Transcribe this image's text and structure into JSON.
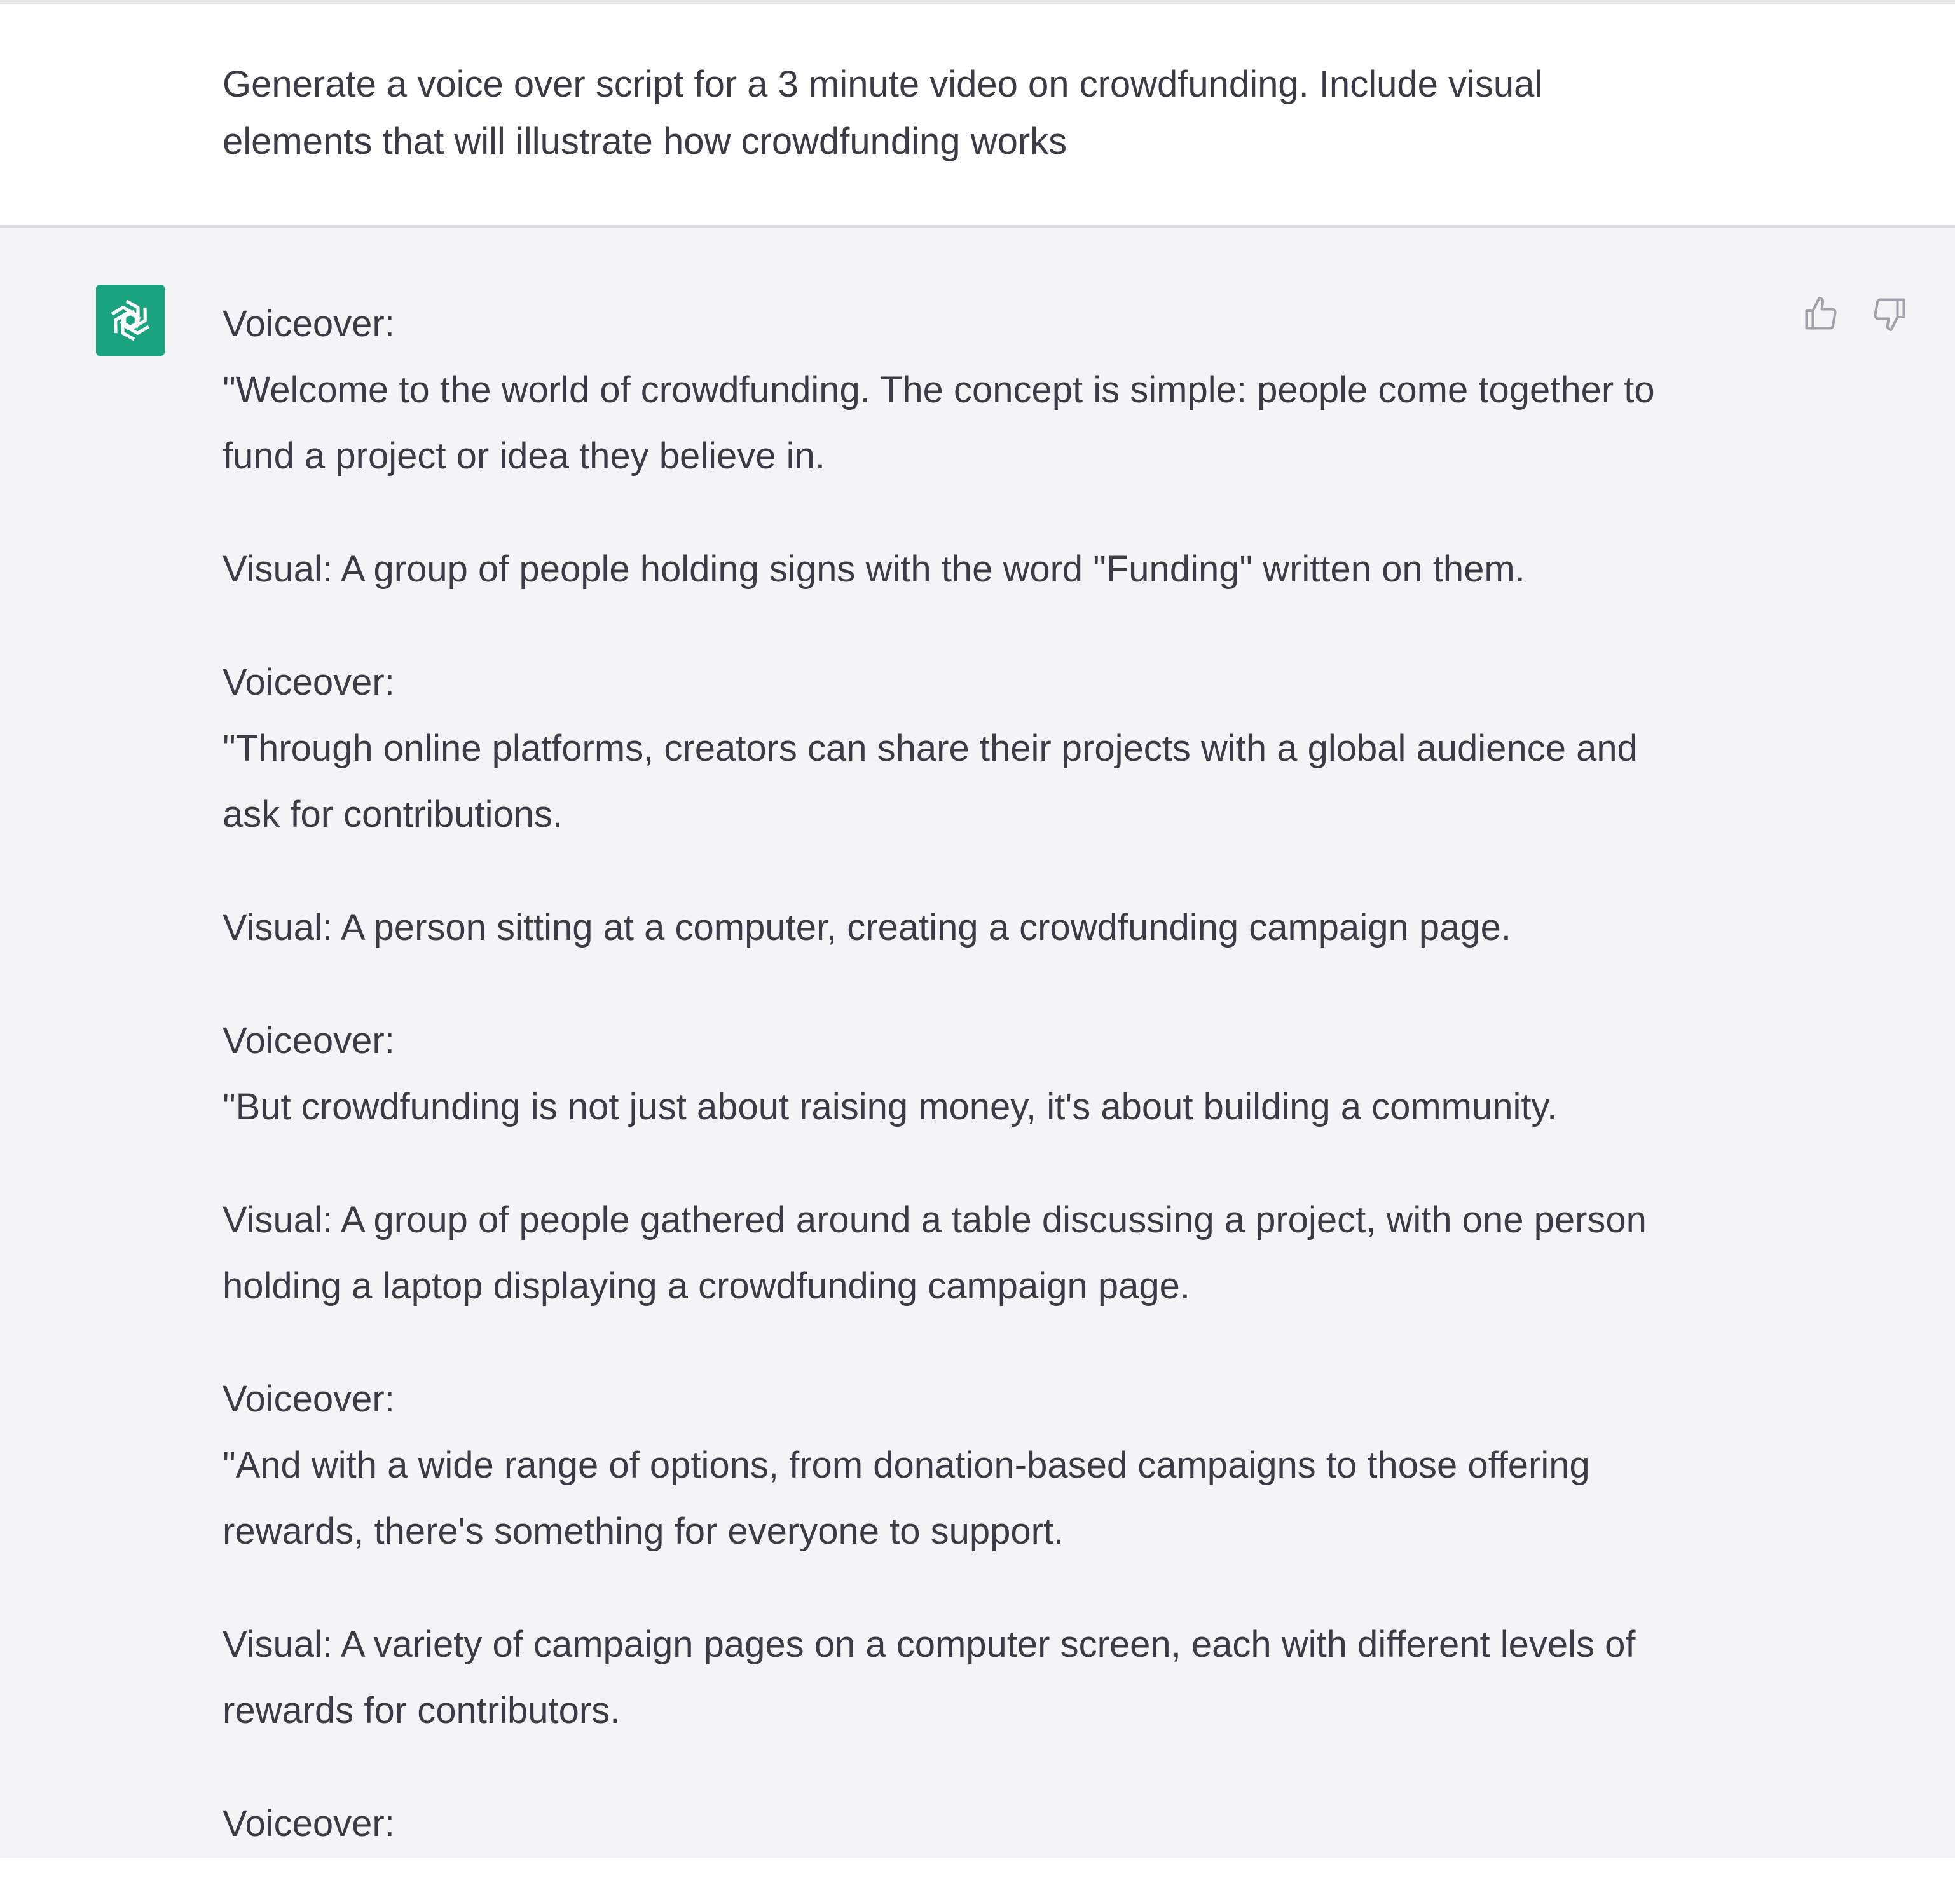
{
  "user_message": {
    "text": "Generate a voice over script for a 3 minute video on crowdfunding.  Include visual\nelements that will illustrate how crowdfunding works"
  },
  "assistant": {
    "avatar_icon": "openai-logo-icon",
    "avatar_color": "#19a37f",
    "feedback": {
      "thumbs_up_icon": "thumbs-up-icon",
      "thumbs_down_icon": "thumbs-down-icon"
    },
    "paragraphs": [
      "Voiceover:\n\"Welcome to the world of crowdfunding. The concept is simple: people come together to\nfund a project or idea they believe in.",
      "Visual: A group of people holding signs with the word \"Funding\" written on them.",
      "Voiceover:\n\"Through online platforms, creators can share their projects with a global audience and\nask for contributions.",
      "Visual: A person sitting at a computer, creating a crowdfunding campaign page.",
      "Voiceover:\n\"But crowdfunding is not just about raising money, it's about building a community.",
      "Visual: A group of people gathered around a table discussing a project, with one person\nholding a laptop displaying a crowdfunding campaign page.",
      "Voiceover:\n\"And with a wide range of options, from donation-based campaigns to those offering\nrewards, there's something for everyone to support.",
      "Visual: A variety of campaign pages on a computer screen, each with different levels of\nrewards for contributors.",
      "Voiceover:"
    ]
  }
}
